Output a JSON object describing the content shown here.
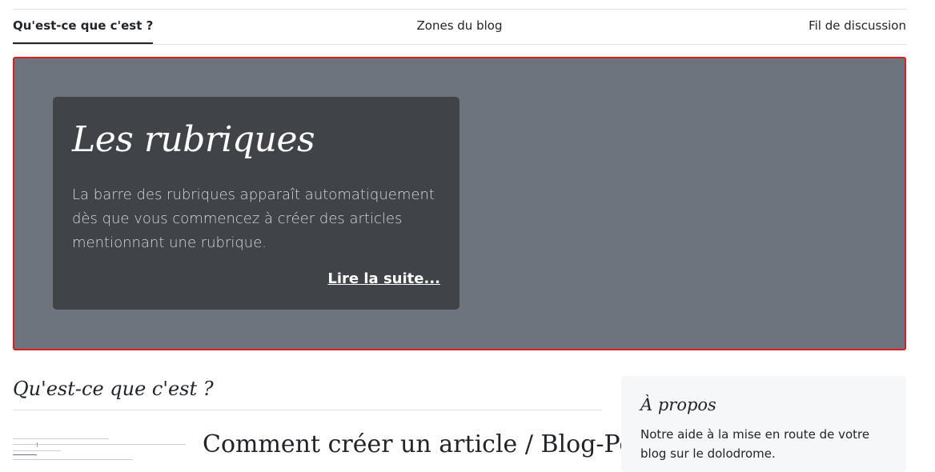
{
  "tabs": [
    {
      "label": "Qu'est-ce que c'est ?",
      "active": true
    },
    {
      "label": "Zones du blog",
      "active": false
    },
    {
      "label": "Fil de discussion",
      "active": false
    }
  ],
  "hero": {
    "title": "Les rubriques",
    "text": "La barre des rubriques apparaît automatiquement dès que vous commencez à créer des articles mentionnant une rubrique.",
    "link": "Lire la suite..."
  },
  "section": {
    "title": "Qu'est-ce que c'est ?"
  },
  "article": {
    "title": "Comment créer un article / Blog-Post ?"
  },
  "sidebar": {
    "title": "À propos",
    "text": "Notre aide à la mise en route de votre blog sur le dolodrome."
  },
  "colors": {
    "hero_bg": "#6c757d",
    "card_bg": "#404448",
    "highlight_border": "#dc1e1e"
  }
}
